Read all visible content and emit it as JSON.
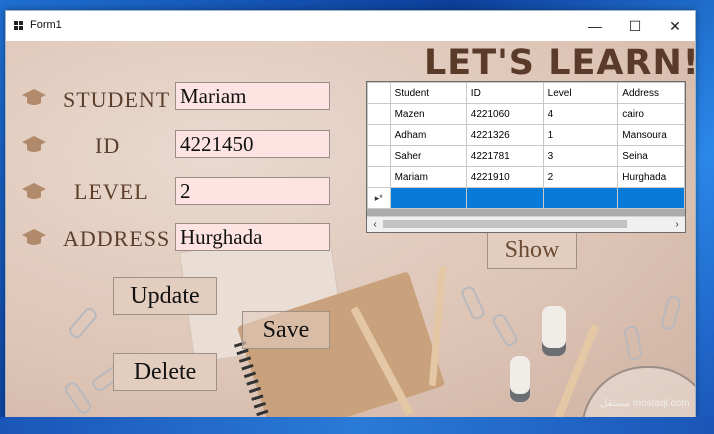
{
  "window": {
    "title": "Form1",
    "minimize": "—",
    "maximize": "☐",
    "close": "✕"
  },
  "heading": "LET'S LEARN!",
  "form": {
    "fields": [
      {
        "label": "STUDENT",
        "value": "Mariam"
      },
      {
        "label": "ID",
        "value": "4221450"
      },
      {
        "label": "LEVEL",
        "value": "2"
      },
      {
        "label": "ADDRESS",
        "value": "Hurghada"
      }
    ],
    "buttons": {
      "update": "Update",
      "save": "Save",
      "delete": "Delete",
      "show": "Show"
    }
  },
  "grid": {
    "columns": [
      "Student",
      "ID",
      "Level",
      "Address"
    ],
    "rows": [
      [
        "Mazen",
        "4221060",
        "4",
        "cairo"
      ],
      [
        "Adham",
        "4221326",
        "1",
        "Mansoura"
      ],
      [
        "Saher",
        "4221781",
        "3",
        "Seina"
      ],
      [
        "Mariam",
        "4221910",
        "2",
        "Hurghada"
      ]
    ],
    "new_row_marker": "▸*",
    "scroll_left": "‹",
    "scroll_right": "›"
  },
  "watermark": "مستقل mostaql.com",
  "colors": {
    "heading": "#5a3b2a",
    "field_bg": "#fde4e2",
    "button_bg": "#e2cdbf",
    "selection": "#0a7ad8"
  }
}
